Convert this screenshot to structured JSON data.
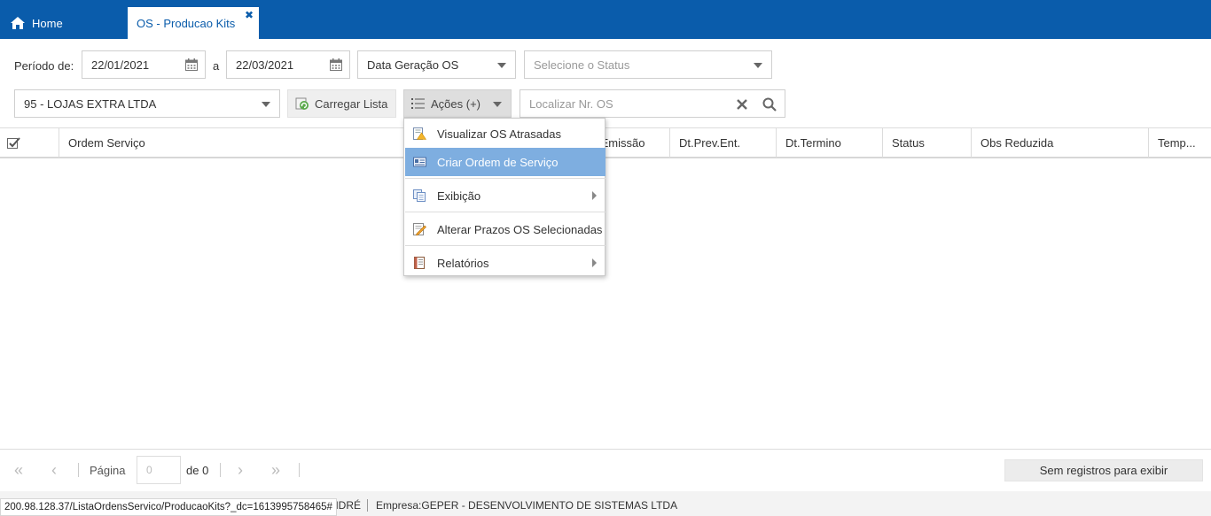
{
  "tabs": {
    "home_label": "Home",
    "active_label": "OS - Producao Kits",
    "close_glyph": "✖"
  },
  "filters": {
    "periodo_label": "Período de:",
    "date_from": "22/01/2021",
    "separator_label": "a",
    "date_to": "22/03/2021",
    "date_type": "Data Geração OS",
    "status_placeholder": "Selecione o Status",
    "company_select": "95 - LOJAS EXTRA LTDA",
    "load_button": "Carregar Lista",
    "actions_button": "Ações (+)",
    "search_placeholder": "Localizar Nr. OS"
  },
  "table": {
    "columns": [
      "Ordem Serviço",
      "Dt.Emissão",
      "Dt.Prev.Ent.",
      "Dt.Termino",
      "Status",
      "Obs Reduzida",
      "Temp..."
    ]
  },
  "actions_menu": {
    "items": [
      {
        "label": "Visualizar OS Atrasadas",
        "icon": "warning-report-icon"
      },
      {
        "label": "Criar Ordem de Serviço",
        "icon": "create-os-icon",
        "active": true
      },
      {
        "label": "Exibição",
        "icon": "copy-pages-icon",
        "submenu": true
      },
      {
        "label": "Alterar Prazos OS Selecionadas",
        "icon": "edit-pencil-icon"
      },
      {
        "label": "Relatórios",
        "icon": "report-book-icon",
        "submenu": true
      }
    ]
  },
  "pager": {
    "page_label": "Página",
    "page_value": "0",
    "of_label": "de 0",
    "no_records": "Sem registros para exibir"
  },
  "statusbar": {
    "url": "200.98.128.37/ListaOrdensServico/ProducaoKits?_dc=1613995758465#",
    "user_fragment": "NDRÉ",
    "empresa_label": "Empresa:",
    "empresa_value": "GEPER - DESENVOLVIMENTO DE SISTEMAS LTDA"
  },
  "colors": {
    "topbar": "#0a5cab",
    "menu_active": "#7eaee0"
  }
}
